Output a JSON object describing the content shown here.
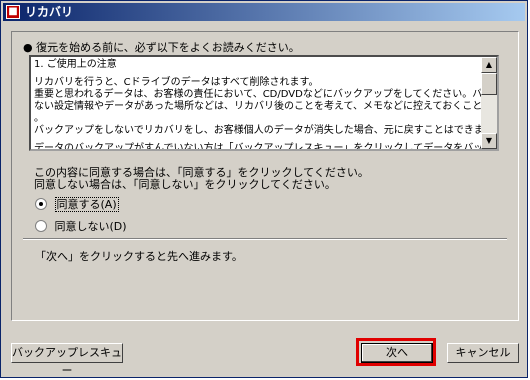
{
  "window": {
    "title": "リカバリ"
  },
  "heading": "● 復元を始める前に、必ず以下をよくお読みください。",
  "notice": {
    "lines": [
      "1. ご使用上の注意",
      "リカバリを行うと、Cドライブのデータはすべて削除されます。",
      "重要と思われるデータは、お客様の責任において、CD/DVDなどにバックアップをしてください。バックアップでき",
      "ない設定情報やデータがあった場所などは、リカバリ後のことを考えて、メモなどに控えておくことをお勧めします",
      "。",
      "バックアップをしないでリカバリをし、お客様個人のデータが消失した場合、元に戻すことはできません。",
      "データのバックアップがすんでいない方は「バックアップレスキュー」をクリックしてデータをバックアップしてくださ"
    ]
  },
  "agree_text": {
    "line1": "この内容に同意する場合は、「同意する」をクリックしてください。",
    "line2": "同意しない場合は、「同意しない」をクリックしてください。"
  },
  "radios": {
    "agree": {
      "label": "同意する(A)",
      "checked": true
    },
    "disagree": {
      "label": "同意しない(D)",
      "checked": false
    }
  },
  "next_note": "「次へ」をクリックすると先へ進みます。",
  "buttons": {
    "backup": "バックアップレスキュー",
    "next": "次へ",
    "cancel": "キャンセル"
  },
  "colors": {
    "highlight": "#e00000",
    "titlebar": "#0a246a"
  }
}
